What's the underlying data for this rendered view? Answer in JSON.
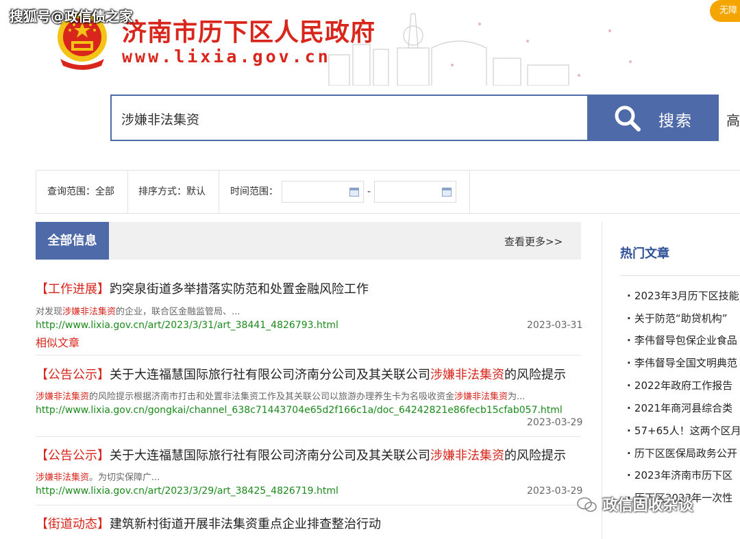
{
  "watermark_top": "搜狐号@政信债之家",
  "watermark_bottom": "政信固收杂谈",
  "badge_top": "无障",
  "site": {
    "title": "济南市历下区人民政府",
    "url": "www.lixia.gov.cn"
  },
  "search": {
    "value": "涉嫌非法集资",
    "button_label": "搜索",
    "advanced_label": "高"
  },
  "filters": {
    "scope_label": "查询范围：全部",
    "sort_label": "排序方式：默认",
    "time_label": "时间范围：",
    "date_separator": "-"
  },
  "tabs": {
    "active": "全部信息",
    "more": "查看更多>>"
  },
  "results": [
    {
      "tag": "【工作进展】",
      "title": "趵突泉街道多举措落实防范和处置金融风险工作",
      "summary_pre": "对发现",
      "summary_hl": "涉嫌非法集资",
      "summary_post": "的企业，联合区金融监管局、...",
      "url": "http://www.lixia.gov.cn/art/2023/3/31/art_38441_4826793.html",
      "date": "2023-03-31",
      "similar": "相似文章"
    },
    {
      "tag": "【公告公示】",
      "title_pre": "关于大连福慧国际旅行社有限公司济南分公司及其关联公司",
      "title_hl": "涉嫌非法集资",
      "title_post": "的风险提示",
      "summary_hl1": "涉嫌非法集资",
      "summary_mid": "的风险提示根据济南市打击和处置非法集资工作及其关联公司以旅游办理养生卡为名吸收资金",
      "summary_hl2": "涉嫌非法集资",
      "summary_post": "为...",
      "url": "http://www.lixia.gov.cn/gongkai/channel_638c71443704e65d2f166c1a/doc_64242821e86fecb15cfab057.html",
      "date": "2023-03-29"
    },
    {
      "tag": "【公告公示】",
      "title_pre": "关于大连福慧国际旅行社有限公司济南分公司及其关联公司",
      "title_hl": "涉嫌非法集资",
      "title_post": "的风险提示",
      "summary_hl": "涉嫌非法集资",
      "summary_post": "。为切实保障广...",
      "url": "http://www.lixia.gov.cn/art/2023/3/29/art_38425_4826719.html",
      "date": "2023-03-29"
    },
    {
      "tag": "【街道动态】",
      "title": "建筑新村街道开展非法集资重点企业排查整治行动"
    }
  ],
  "hot": {
    "title": "热门文章",
    "items": [
      "2023年3月历下区技能",
      "关于防范“助贷机构”",
      "李伟督导包保企业食品",
      "李伟督导全国文明典范",
      "2022年政府工作报告",
      "2021年商河县综合类",
      "57+65人！这两个区月",
      "历下区医保局政务公开",
      "2023年济南市历下区",
      "历下区2023年一次性"
    ]
  },
  "colors": {
    "brand_red": "#d9261c",
    "brand_blue": "#4f6aa8",
    "url_green": "#1a8a1a"
  }
}
